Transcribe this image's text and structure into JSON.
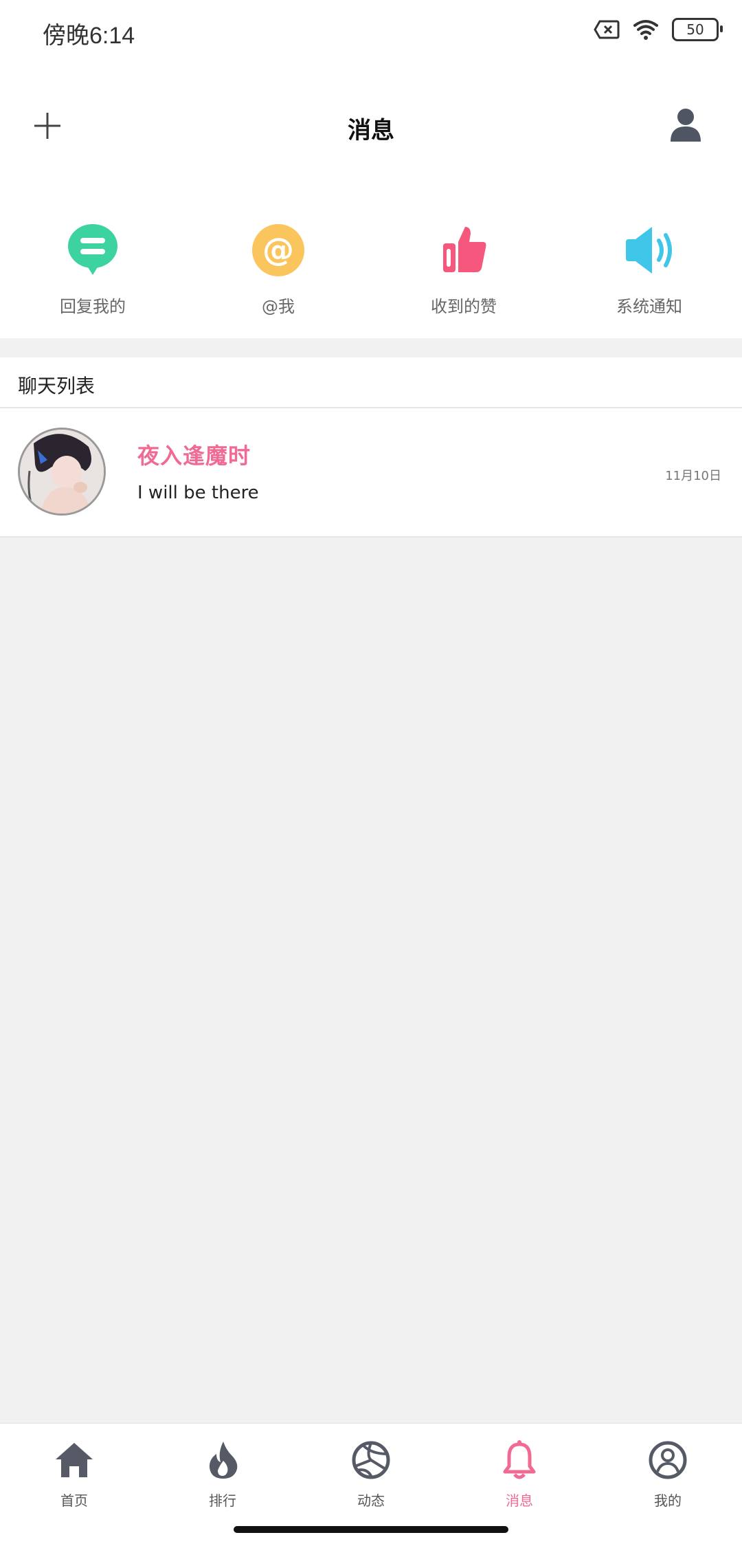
{
  "status_bar": {
    "time": "傍晚6:14",
    "battery": "50"
  },
  "header": {
    "title": "消息"
  },
  "quick_actions": [
    {
      "label": "回复我的",
      "icon": "reply-bubble-icon",
      "color": "#3dd3a0"
    },
    {
      "label": "@我",
      "icon": "at-icon",
      "color": "#fbc55d"
    },
    {
      "label": "收到的赞",
      "icon": "thumbs-up-icon",
      "color": "#f5587c"
    },
    {
      "label": "系统通知",
      "icon": "speaker-icon",
      "color": "#3fc6e8"
    }
  ],
  "chat_list": {
    "title": "聊天列表",
    "items": [
      {
        "name": "夜入逢魔时",
        "message": "I will be there",
        "date": "11月10日"
      }
    ]
  },
  "bottom_nav": [
    {
      "label": "首页",
      "icon": "home-icon"
    },
    {
      "label": "排行",
      "icon": "flame-icon"
    },
    {
      "label": "动态",
      "icon": "volleyball-icon"
    },
    {
      "label": "消息",
      "icon": "bell-icon",
      "active": true
    },
    {
      "label": "我的",
      "icon": "user-circle-icon"
    }
  ],
  "colors": {
    "accent": "#f06a93",
    "nav_inactive": "#555a66"
  }
}
